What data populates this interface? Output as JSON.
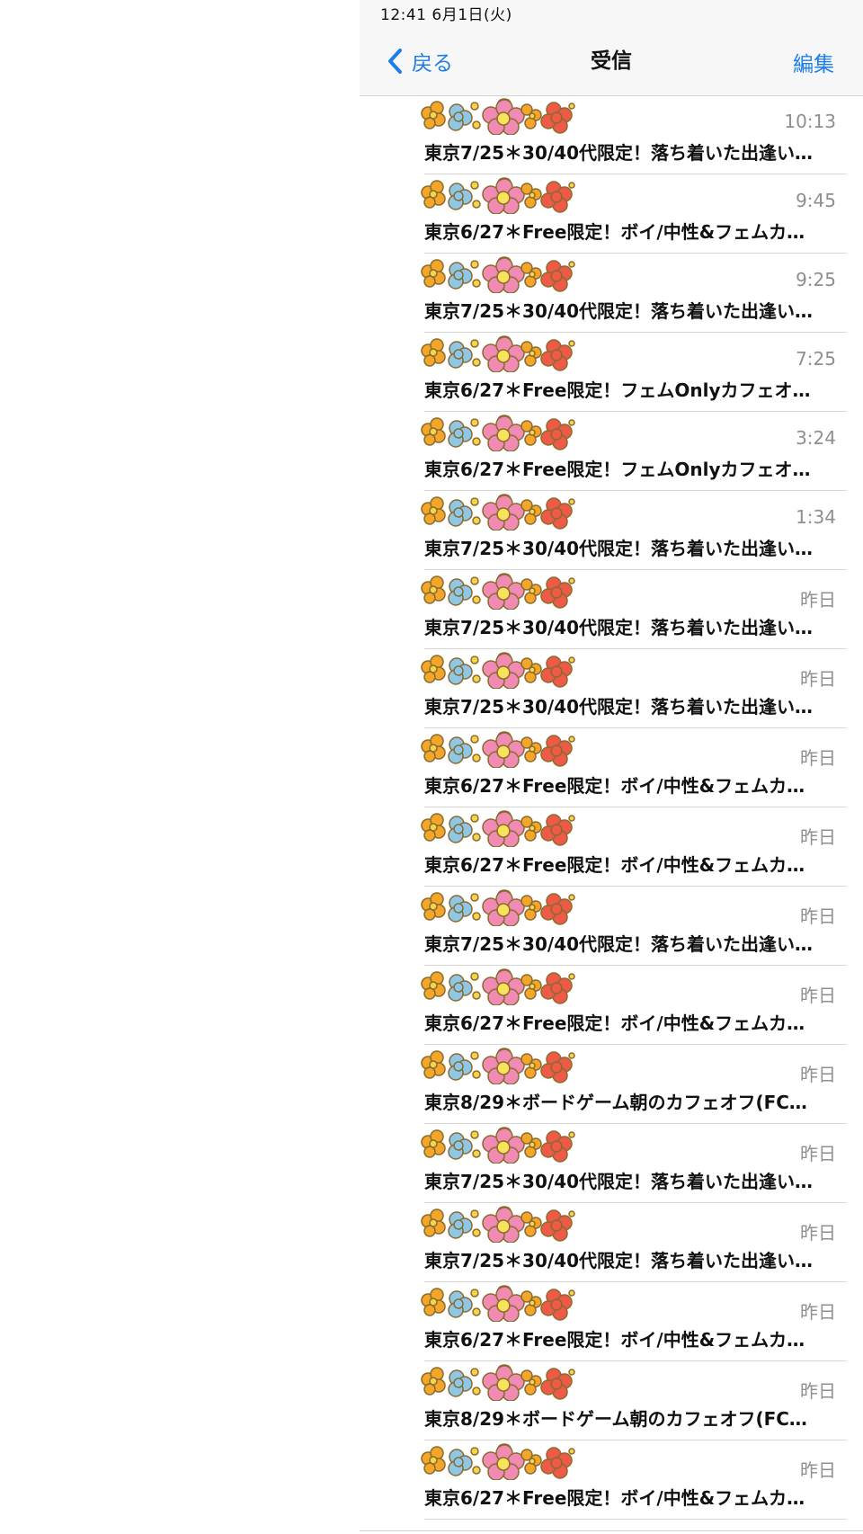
{
  "status_bar": {
    "time_date": "12:41   6月1日(火)"
  },
  "nav": {
    "back_label": "戻る",
    "title": "受信",
    "edit_label": "編集"
  },
  "colors": {
    "accent": "#1f7de6",
    "secondary_text": "#8e8e93"
  },
  "sender_icon": "flower-row-icon",
  "messages": [
    {
      "time": "10:13",
      "subject": "東京7/25＊30/40代限定！落ち着いた出逢い…"
    },
    {
      "time": "9:45",
      "subject": "東京6/27＊Free限定！ボイ/中性&フェムカ…"
    },
    {
      "time": "9:25",
      "subject": "東京7/25＊30/40代限定！落ち着いた出逢い…"
    },
    {
      "time": "7:25",
      "subject": "東京6/27＊Free限定！フェムOnlyカフェオ…"
    },
    {
      "time": "3:24",
      "subject": "東京6/27＊Free限定！フェムOnlyカフェオ…"
    },
    {
      "time": "1:34",
      "subject": "東京7/25＊30/40代限定！落ち着いた出逢い…"
    },
    {
      "time": "昨日",
      "subject": "東京7/25＊30/40代限定！落ち着いた出逢い…"
    },
    {
      "time": "昨日",
      "subject": "東京7/25＊30/40代限定！落ち着いた出逢い…"
    },
    {
      "time": "昨日",
      "subject": "東京6/27＊Free限定！ボイ/中性&フェムカ…"
    },
    {
      "time": "昨日",
      "subject": "東京6/27＊Free限定！ボイ/中性&フェムカ…"
    },
    {
      "time": "昨日",
      "subject": "東京7/25＊30/40代限定！落ち着いた出逢い…"
    },
    {
      "time": "昨日",
      "subject": "東京6/27＊Free限定！ボイ/中性&フェムカ…"
    },
    {
      "time": "昨日",
      "subject": "東京8/29＊ボードゲーム朝のカフェオフ(FC…"
    },
    {
      "time": "昨日",
      "subject": "東京7/25＊30/40代限定！落ち着いた出逢い…"
    },
    {
      "time": "昨日",
      "subject": "東京7/25＊30/40代限定！落ち着いた出逢い…"
    },
    {
      "time": "昨日",
      "subject": "東京6/27＊Free限定！ボイ/中性&フェムカ…"
    },
    {
      "time": "昨日",
      "subject": "東京8/29＊ボードゲーム朝のカフェオフ(FC…"
    },
    {
      "time": "昨日",
      "subject": "東京6/27＊Free限定！ボイ/中性&フェムカ…"
    }
  ]
}
